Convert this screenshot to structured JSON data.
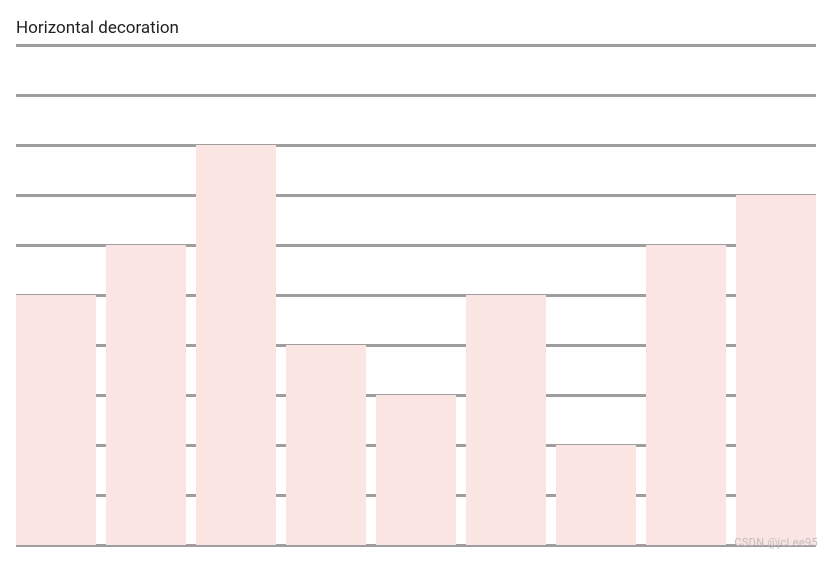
{
  "title": "Horizontal decoration",
  "watermark": "CSDN @jcLee95",
  "chart_data": {
    "type": "bar",
    "title": "Horizontal decoration",
    "xlabel": "",
    "ylabel": "",
    "ylim": [
      0,
      10
    ],
    "grid_y_values": [
      0,
      1,
      2,
      3,
      4,
      5,
      6,
      7,
      8,
      9,
      10
    ],
    "values": [
      5,
      6,
      8,
      4,
      3,
      5,
      2,
      6,
      7
    ],
    "bar_color": "#fae5e3",
    "grid_color": "#9e9e9e"
  }
}
